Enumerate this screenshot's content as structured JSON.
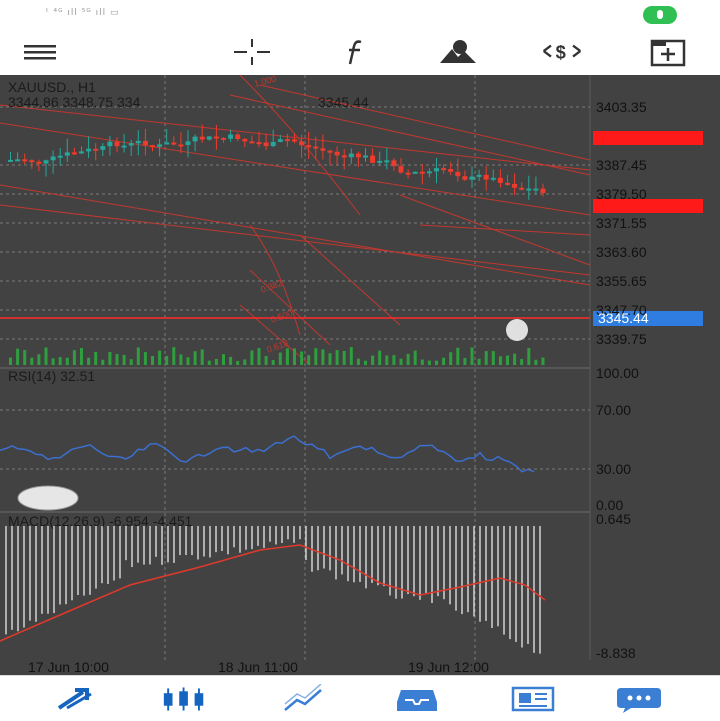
{
  "status": {
    "signal_text": "ᵗ ⁴ᴳ ıll ⁵ᴳ ıll ▭"
  },
  "toolbar": {
    "icons": [
      "menu-icon",
      "crosshair-icon",
      "function-icon",
      "objects-icon",
      "trade-icon",
      "add-window-icon"
    ]
  },
  "chart": {
    "symbol_header": "XAUUSD., H1",
    "ohlc_line": "3344.86 3348.75 334",
    "ohlc_tail": "3345.44",
    "price_levels": [
      "3403.35",
      "3387.45",
      "3379.50",
      "3371.55",
      "3363.60",
      "3355.65",
      "3347.70",
      "3339.75"
    ],
    "current_price": "3345.44",
    "rsi_label": "RSI(14) 32.51",
    "rsi_levels": [
      "100.00",
      "70.00",
      "30.00",
      "0.00"
    ],
    "macd_label": "MACD(12,26,9) -6.954 -4.451",
    "macd_levels": [
      "0.645",
      "-8.838"
    ],
    "time_labels": [
      "17 Jun 10:00",
      "18 Jun 11:00",
      "19 Jun 12:00"
    ],
    "colors": {
      "bull": "#26a69a",
      "bear": "#ef3b2c",
      "background": "#424242",
      "price_tag": "#2f7de1",
      "alert": "#ff1a1a"
    }
  },
  "nav": {
    "icons": [
      "quotes-icon",
      "chart-icon",
      "trade-icon",
      "history-icon",
      "news-icon",
      "messages-icon"
    ]
  }
}
